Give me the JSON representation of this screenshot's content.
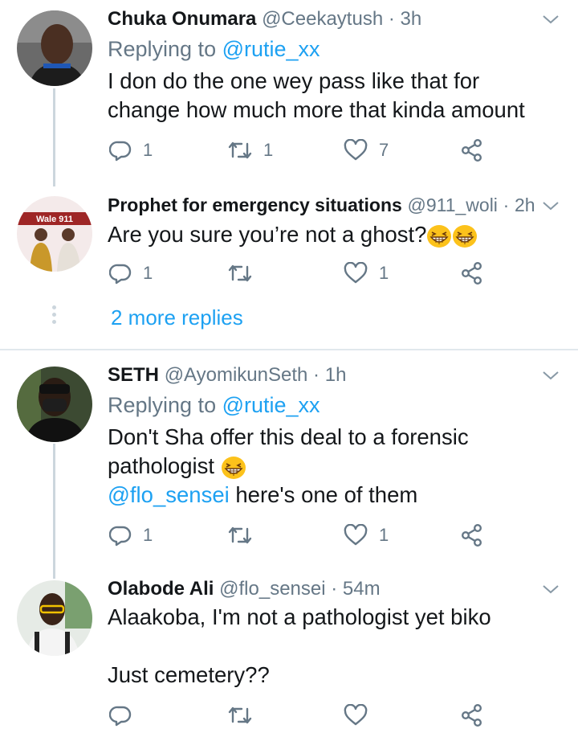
{
  "colors": {
    "link": "#1da1f2",
    "secondary": "#657786",
    "text": "#14171a",
    "thread_line": "#ccd6dd"
  },
  "tweets": [
    {
      "name": "Chuka Onumara",
      "handle": "@Ceekaytush",
      "separator": "·",
      "time": "3h",
      "replying_prefix": "Replying to ",
      "replying_to": "@rutie_xx",
      "lines": [
        "I don do the one wey pass like that for",
        "change how much more that kinda amount"
      ],
      "reply_count": "1",
      "retweet_count": "1",
      "like_count": "7"
    },
    {
      "name": "Prophet for emergency situations",
      "handle": "@911_woli",
      "separator": "·",
      "time": "2h",
      "avatar_text": "Wale 911",
      "lines": [
        "Are you sure you’re not a ghost?"
      ],
      "emoji": [
        "grinning-squinting-emoji",
        "grinning-squinting-emoji"
      ],
      "reply_count": "1",
      "retweet_count": "",
      "like_count": "1"
    },
    {
      "name": "SETH",
      "handle": "@AyomikunSeth",
      "separator": "·",
      "time": "1h",
      "replying_prefix": "Replying to ",
      "replying_to": "@rutie_xx",
      "lines": [
        "Don't Sha offer this deal to a forensic",
        "pathologist "
      ],
      "mention_line": {
        "mention": "@flo_sensei",
        "text": " here's one of them"
      },
      "emoji": [
        "grinning-squinting-emoji"
      ],
      "reply_count": "1",
      "retweet_count": "",
      "like_count": "1"
    },
    {
      "name": "Olabode Ali",
      "handle": "@flo_sensei",
      "separator": "·",
      "time": "54m",
      "lines": [
        "Alaakoba, I'm not a pathologist yet biko",
        "Just cemetery??"
      ],
      "reply_count": "",
      "retweet_count": "",
      "like_count": ""
    }
  ],
  "more_replies": "2 more replies",
  "icons": [
    "reply-icon",
    "retweet-icon",
    "like-icon",
    "share-icon",
    "chevron-down-icon"
  ]
}
